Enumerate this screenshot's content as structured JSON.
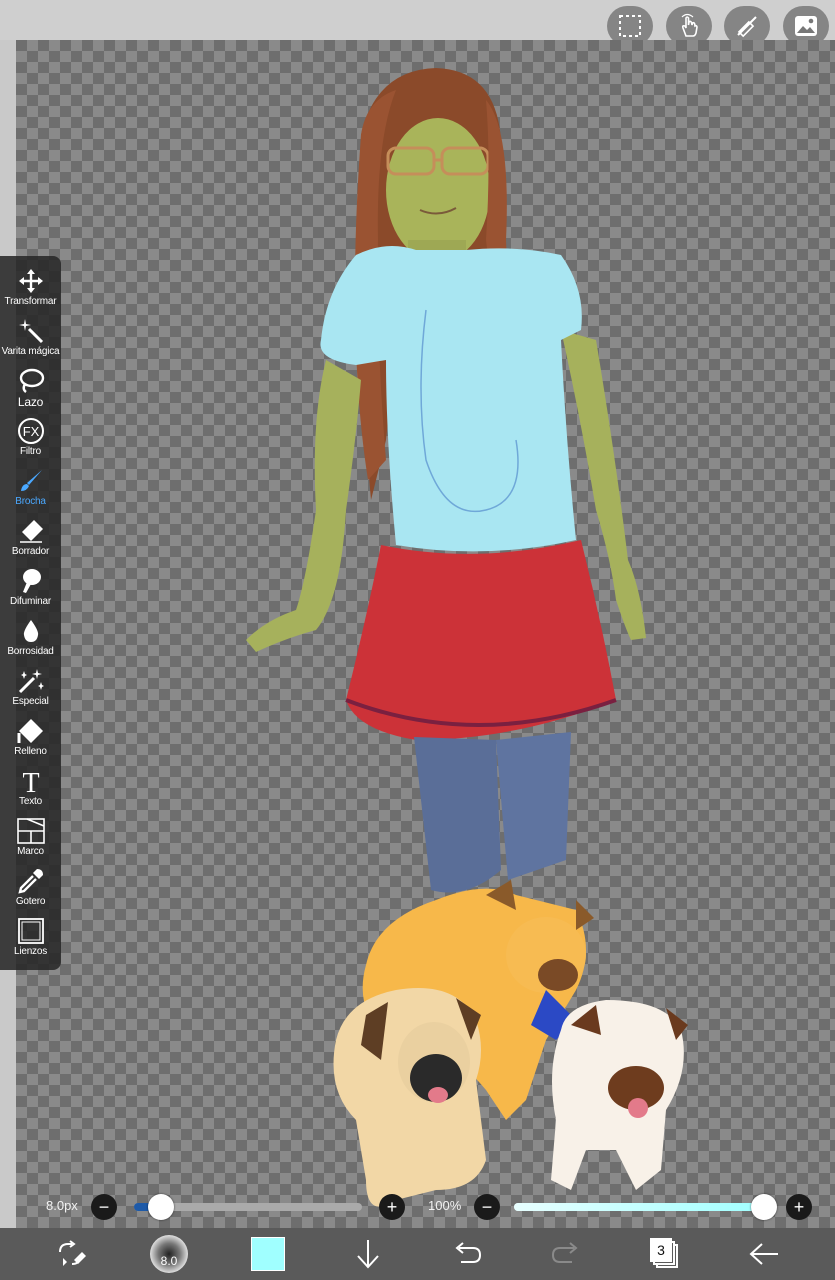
{
  "toolbar": {
    "items": [
      {
        "label": "Transformar",
        "icon": "move-arrows-icon"
      },
      {
        "label": "Varita mágica",
        "icon": "magic-wand-icon"
      },
      {
        "label": "Lazo",
        "icon": "lasso-icon"
      },
      {
        "label": "Filtro",
        "icon": "fx-icon"
      },
      {
        "label": "Brocha",
        "icon": "brush-icon"
      },
      {
        "label": "Borrador",
        "icon": "eraser-icon"
      },
      {
        "label": "Difuminar",
        "icon": "blur-finger-icon"
      },
      {
        "label": "Borrosidad",
        "icon": "drop-icon"
      },
      {
        "label": "Especial",
        "icon": "sparkle-wand-icon"
      },
      {
        "label": "Relleno",
        "icon": "fill-bucket-icon"
      },
      {
        "label": "Texto",
        "icon": "text-icon"
      },
      {
        "label": "Marco",
        "icon": "frame-icon"
      },
      {
        "label": "Gotero",
        "icon": "eyedropper-icon"
      },
      {
        "label": "Lienzos",
        "icon": "canvas-icon"
      }
    ],
    "active": "Brocha"
  },
  "sliders": {
    "brush_size": {
      "text": "8.0px",
      "fraction": 0.12
    },
    "opacity": {
      "text": "100%",
      "fraction": 1.0
    }
  },
  "bottom_bar": {
    "brush_preview_text": "8.0",
    "current_color": "#a0ffff",
    "layer_count": "3"
  },
  "colors": {
    "accent": "#4aa8ff",
    "slider_fill_left": "#1e5aa8",
    "color_swatch": "#a0ffff"
  }
}
